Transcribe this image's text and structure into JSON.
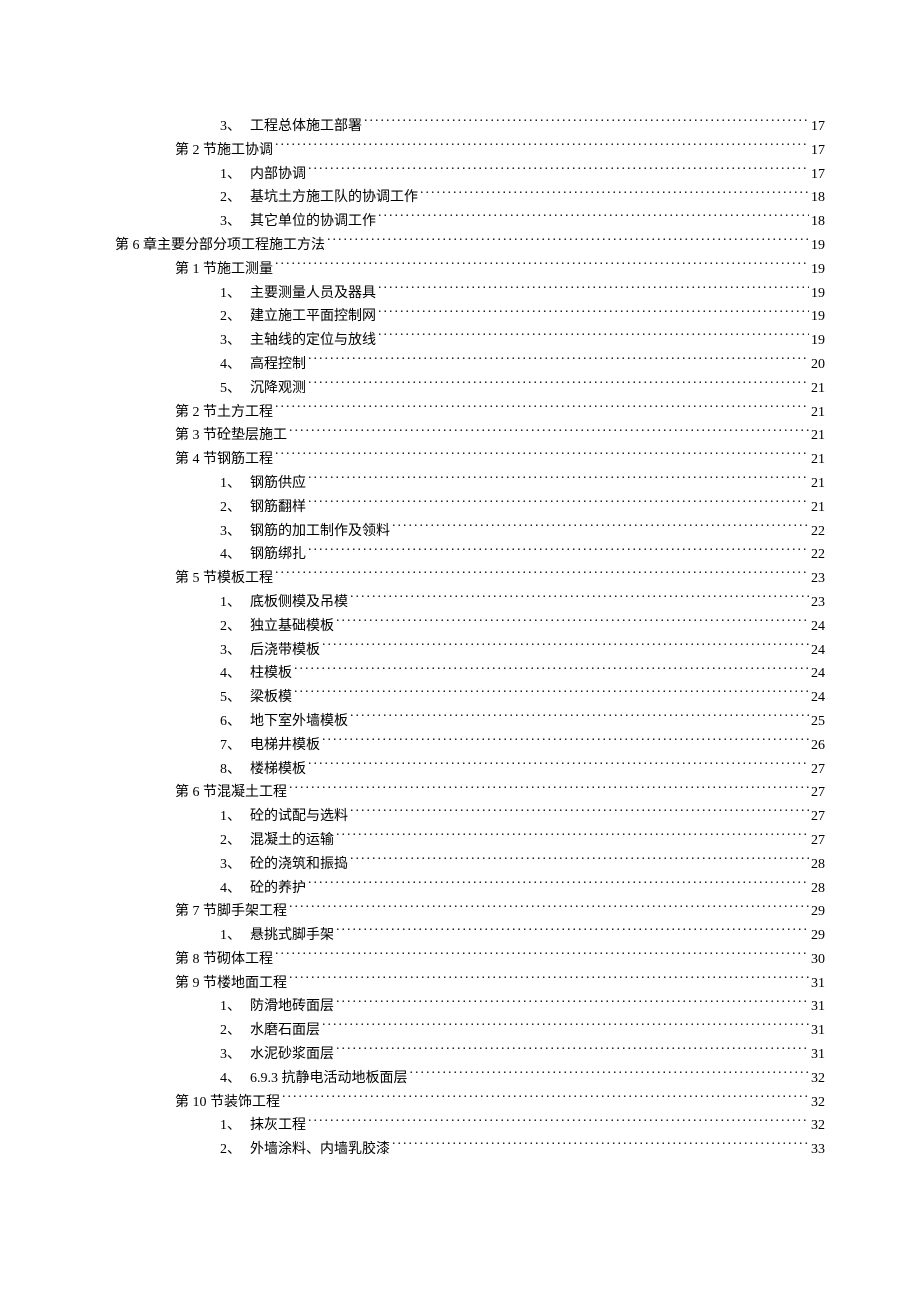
{
  "toc": [
    {
      "level": "item",
      "num": "3、",
      "title": "工程总体施工部署",
      "page": "17"
    },
    {
      "level": "section",
      "num": "第 2 节",
      "title": " 施工协调",
      "page": "17"
    },
    {
      "level": "item",
      "num": "1、",
      "title": "内部协调",
      "page": "17"
    },
    {
      "level": "item",
      "num": "2、",
      "title": "基坑土方施工队的协调工作",
      "page": "18"
    },
    {
      "level": "item",
      "num": "3、",
      "title": "其它单位的协调工作",
      "page": "18"
    },
    {
      "level": "chapter",
      "num": "第 6 章",
      "title": " 主要分部分项工程施工方法",
      "page": "19"
    },
    {
      "level": "section",
      "num": "第 1 节",
      "title": " 施工测量",
      "page": "19"
    },
    {
      "level": "item",
      "num": "1、",
      "title": "主要测量人员及器具",
      "page": "19"
    },
    {
      "level": "item",
      "num": "2、",
      "title": "建立施工平面控制网",
      "page": "19"
    },
    {
      "level": "item",
      "num": "3、",
      "title": "主轴线的定位与放线",
      "page": "19"
    },
    {
      "level": "item",
      "num": "4、",
      "title": "高程控制",
      "page": "20"
    },
    {
      "level": "item",
      "num": "5、",
      "title": "沉降观测",
      "page": "21"
    },
    {
      "level": "section",
      "num": "第 2 节",
      "title": " 土方工程",
      "page": "21"
    },
    {
      "level": "section",
      "num": "第 3 节",
      "title": " 砼垫层施工",
      "page": "21"
    },
    {
      "level": "section",
      "num": "第 4 节",
      "title": " 钢筋工程",
      "page": "21"
    },
    {
      "level": "item",
      "num": "1、",
      "title": "钢筋供应",
      "page": "21"
    },
    {
      "level": "item",
      "num": "2、",
      "title": "钢筋翻样",
      "page": "21"
    },
    {
      "level": "item",
      "num": "3、",
      "title": "钢筋的加工制作及领料",
      "page": "22"
    },
    {
      "level": "item",
      "num": "4、",
      "title": "钢筋绑扎",
      "page": "22"
    },
    {
      "level": "section",
      "num": "第 5 节",
      "title": " 模板工程",
      "page": "23"
    },
    {
      "level": "item",
      "num": "1、",
      "title": "底板侧模及吊模",
      "page": "23"
    },
    {
      "level": "item",
      "num": "2、",
      "title": "独立基础模板",
      "page": "24"
    },
    {
      "level": "item",
      "num": "3、",
      "title": "后浇带模板",
      "page": "24"
    },
    {
      "level": "item",
      "num": "4、",
      "title": "柱模板",
      "page": "24"
    },
    {
      "level": "item",
      "num": "5、",
      "title": "梁板模",
      "page": "24"
    },
    {
      "level": "item",
      "num": "6、",
      "title": "地下室外墙模板",
      "page": "25"
    },
    {
      "level": "item",
      "num": "7、",
      "title": "电梯井模板",
      "page": "26"
    },
    {
      "level": "item",
      "num": "8、",
      "title": "楼梯模板",
      "page": "27"
    },
    {
      "level": "section",
      "num": "第 6 节",
      "title": " 混凝土工程",
      "page": "27"
    },
    {
      "level": "item",
      "num": "1、",
      "title": "砼的试配与选料",
      "page": "27"
    },
    {
      "level": "item",
      "num": "2、",
      "title": "混凝土的运输",
      "page": "27"
    },
    {
      "level": "item",
      "num": "3、",
      "title": "砼的浇筑和振捣",
      "page": "28"
    },
    {
      "level": "item",
      "num": "4、",
      "title": "砼的养护",
      "page": "28"
    },
    {
      "level": "section",
      "num": "第 7 节",
      "title": " 脚手架工程",
      "page": "29"
    },
    {
      "level": "item",
      "num": "1、",
      "title": "悬挑式脚手架",
      "page": "29"
    },
    {
      "level": "section",
      "num": "第 8 节",
      "title": " 砌体工程",
      "page": "30"
    },
    {
      "level": "section",
      "num": "第 9 节",
      "title": " 楼地面工程",
      "page": "31"
    },
    {
      "level": "item",
      "num": "1、",
      "title": "防滑地砖面层",
      "page": "31"
    },
    {
      "level": "item",
      "num": "2、",
      "title": "水磨石面层",
      "page": "31"
    },
    {
      "level": "item",
      "num": "3、",
      "title": "水泥砂浆面层",
      "page": "31"
    },
    {
      "level": "item",
      "num": "4、",
      "title": "6.9.3 抗静电活动地板面层",
      "page": "32"
    },
    {
      "level": "section",
      "num": "第 10 节",
      "title": " 装饰工程",
      "page": "32"
    },
    {
      "level": "item",
      "num": "1、",
      "title": "抹灰工程",
      "page": "32"
    },
    {
      "level": "item",
      "num": "2、",
      "title": "外墙涂料、内墙乳胶漆",
      "page": "33"
    }
  ]
}
